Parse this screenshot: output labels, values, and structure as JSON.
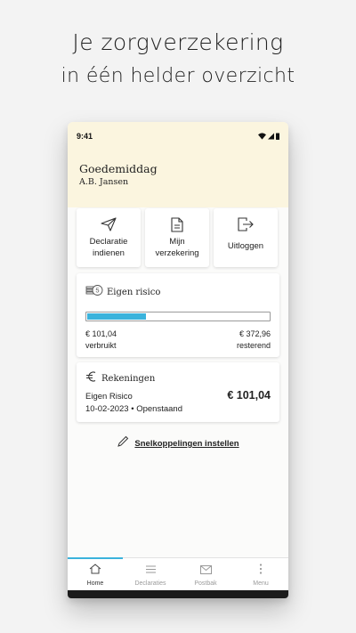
{
  "promo": {
    "line1": "Je zorgverzekering",
    "line2": "in één helder overzicht"
  },
  "status_bar": {
    "time": "9:41"
  },
  "header": {
    "greeting": "Goedemiddag",
    "user_name": "A.B. Jansen"
  },
  "quick_actions": [
    {
      "icon": "paper-plane-icon",
      "label_line1": "Declaratie",
      "label_line2": "indienen"
    },
    {
      "icon": "document-icon",
      "label_line1": "Mijn",
      "label_line2": "verzekering"
    },
    {
      "icon": "logout-icon",
      "label_line1": "Uitloggen",
      "label_line2": ""
    }
  ],
  "eigen_risico": {
    "title": "Eigen risico",
    "icon": "coins-icon",
    "used_amount": "€ 101,04",
    "used_label": "verbruikt",
    "remaining_amount": "€ 372,96",
    "remaining_label": "resterend",
    "used_fraction": 0.332
  },
  "rekeningen": {
    "title": "Rekeningen",
    "icon": "euro-icon",
    "item_name": "Eigen Risico",
    "item_amount": "€ 101,04",
    "item_date": "10-02-2023",
    "item_status": "Openstaand"
  },
  "shortcuts": {
    "label": "Snelkoppelingen instellen",
    "icon": "pencil-icon"
  },
  "bottom_nav": [
    {
      "label": "Home",
      "icon": "home-icon",
      "active": true
    },
    {
      "label": "Declaraties",
      "icon": "list-icon",
      "active": false
    },
    {
      "label": "Postbak",
      "icon": "mail-icon",
      "active": false
    },
    {
      "label": "Menu",
      "icon": "more-vertical-icon",
      "active": false
    }
  ],
  "colors": {
    "header_bg": "#fbf5df",
    "accent": "#3bb3dc",
    "page_bg": "#f3f3f3"
  }
}
